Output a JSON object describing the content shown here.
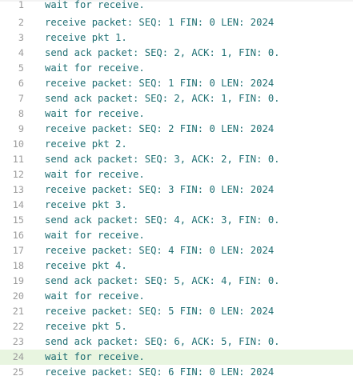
{
  "editor": {
    "active_line": 24,
    "lines": [
      {
        "n": "1",
        "text": "wait for receive."
      },
      {
        "n": "2",
        "text": "receive packet: SEQ: 1 FIN: 0 LEN: 2024"
      },
      {
        "n": "3",
        "text": "receive pkt 1."
      },
      {
        "n": "4",
        "text": "send ack packet: SEQ: 2, ACK: 1, FIN: 0."
      },
      {
        "n": "5",
        "text": "wait for receive."
      },
      {
        "n": "6",
        "text": "receive packet: SEQ: 1 FIN: 0 LEN: 2024"
      },
      {
        "n": "7",
        "text": "send ack packet: SEQ: 2, ACK: 1, FIN: 0."
      },
      {
        "n": "8",
        "text": "wait for receive."
      },
      {
        "n": "9",
        "text": "receive packet: SEQ: 2 FIN: 0 LEN: 2024"
      },
      {
        "n": "10",
        "text": "receive pkt 2."
      },
      {
        "n": "11",
        "text": "send ack packet: SEQ: 3, ACK: 2, FIN: 0."
      },
      {
        "n": "12",
        "text": "wait for receive."
      },
      {
        "n": "13",
        "text": "receive packet: SEQ: 3 FIN: 0 LEN: 2024"
      },
      {
        "n": "14",
        "text": "receive pkt 3."
      },
      {
        "n": "15",
        "text": "send ack packet: SEQ: 4, ACK: 3, FIN: 0."
      },
      {
        "n": "16",
        "text": "wait for receive."
      },
      {
        "n": "17",
        "text": "receive packet: SEQ: 4 FIN: 0 LEN: 2024"
      },
      {
        "n": "18",
        "text": "receive pkt 4."
      },
      {
        "n": "19",
        "text": "send ack packet: SEQ: 5, ACK: 4, FIN: 0."
      },
      {
        "n": "20",
        "text": "wait for receive."
      },
      {
        "n": "21",
        "text": "receive packet: SEQ: 5 FIN: 0 LEN: 2024"
      },
      {
        "n": "22",
        "text": "receive pkt 5."
      },
      {
        "n": "23",
        "text": "send ack packet: SEQ: 6, ACK: 5, FIN: 0."
      },
      {
        "n": "24",
        "text": "wait for receive."
      },
      {
        "n": "25",
        "text": "receive packet: SEQ: 6 FIN: 0 LEN: 2024"
      }
    ]
  }
}
